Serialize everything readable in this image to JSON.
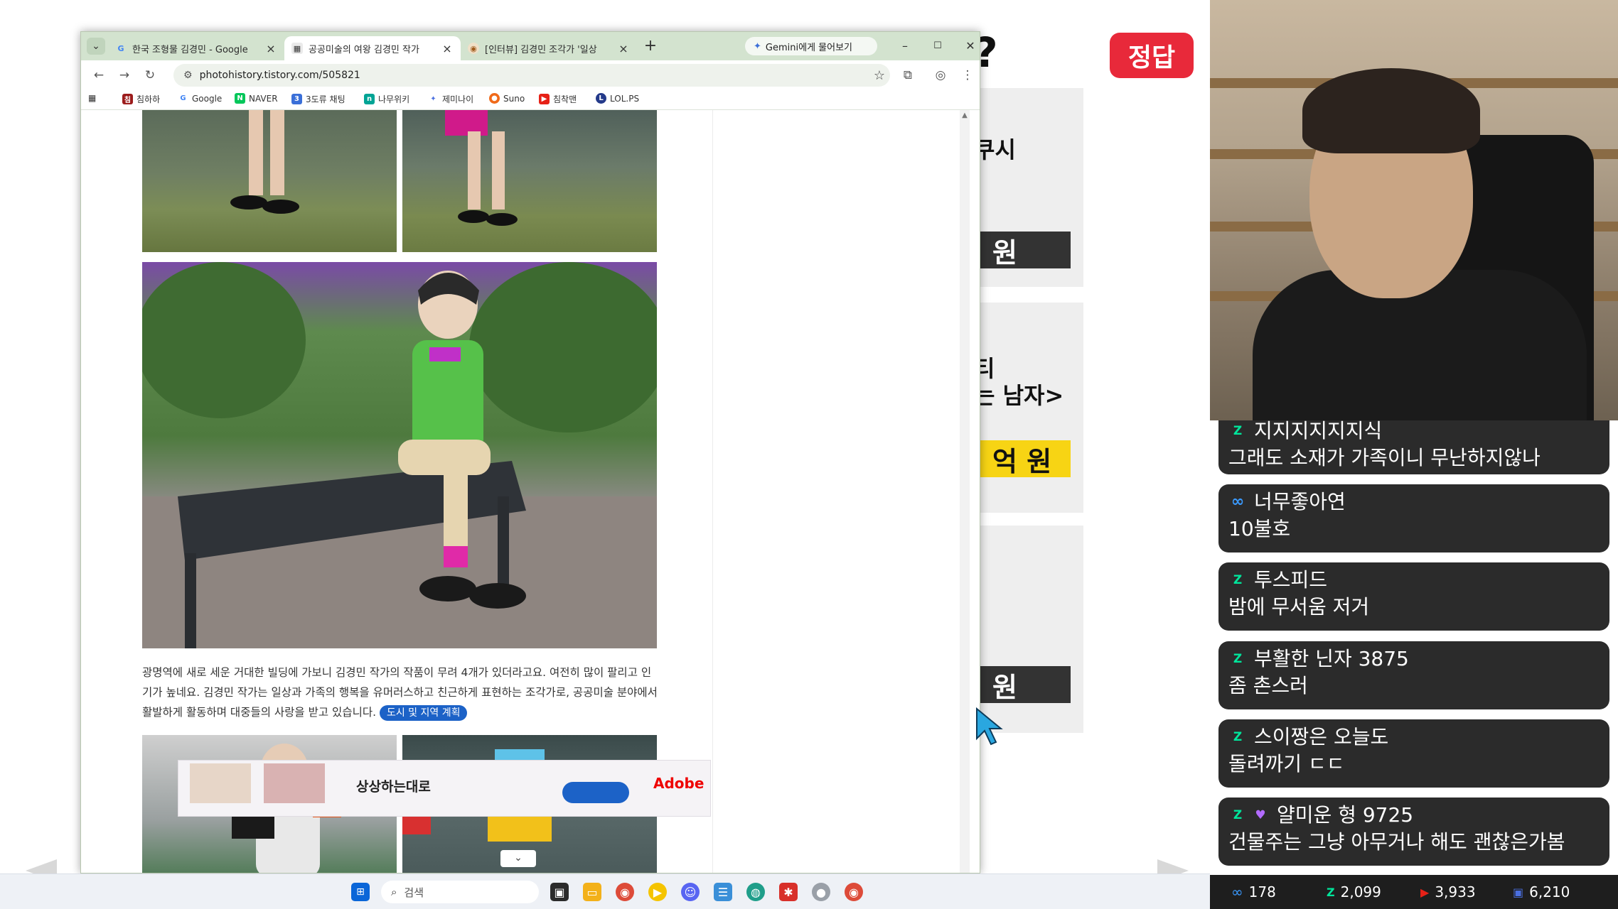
{
  "slide": {
    "title_fragment": "?",
    "answer_badge": "정답",
    "cards": [
      {
        "line1": "쿠시",
        "line2": "",
        "price": "원",
        "price_style": "dark"
      },
      {
        "line1": "티",
        "line2": "는 남자>",
        "price": "억 원",
        "price_style": "yellow"
      },
      {
        "line1": "|",
        "line2": "",
        "price": "원",
        "price_style": "dark"
      }
    ]
  },
  "browser": {
    "tabs": [
      {
        "title": "한국 조형물 김경민 - Google",
        "icon": "google-favicon",
        "active": false
      },
      {
        "title": "공공미술의 여왕 김경민 작가",
        "icon": "tistory-favicon",
        "active": true
      },
      {
        "title": "[인터뷰] 김경민 조각가 '일상",
        "icon": "news-favicon",
        "active": false
      }
    ],
    "gemini_button": "Gemini에게 물어보기",
    "url": "photohistory.tistory.com/505821",
    "bookmarks": [
      {
        "label": "침하하",
        "icon": "chimhaha-icon",
        "color": "#9c1c1c"
      },
      {
        "label": "Google",
        "icon": "google-icon",
        "color": "#4285f4"
      },
      {
        "label": "NAVER",
        "icon": "naver-icon",
        "color": "#03c75a"
      },
      {
        "label": "3도류 채팅",
        "icon": "chat-icon",
        "color": "#3a6fd8"
      },
      {
        "label": "나무위키",
        "icon": "namuwiki-icon",
        "color": "#00a495"
      },
      {
        "label": "제미나이",
        "icon": "gemini-icon",
        "color": "#4a6fe0"
      },
      {
        "label": "Suno",
        "icon": "suno-icon",
        "color": "#f06a1a"
      },
      {
        "label": "침착맨",
        "icon": "youtube-icon",
        "color": "#e62117"
      },
      {
        "label": "LOL.PS",
        "icon": "lolps-icon",
        "color": "#243a8a"
      }
    ]
  },
  "article": {
    "caption": "광명역에 새로 세운 거대한 빌딩에 가보니 김경민 작가의 작품이 무려 4개가 있더라고요. 여전히 많이 팔리고 인기가 높네요. 김경민 작가는 일상과 가족의 행복을 유머러스하고 친근하게 표현하는 조각가로, 공공미술 분야에서 활발하게 활동하며 대중들의 사랑을 받고 있습니다.",
    "link_chip": "도시 및 지역 계획"
  },
  "ad": {
    "headline": "상상하는대로",
    "brand": "Adobe"
  },
  "taskbar": {
    "search_placeholder": "검색"
  },
  "chat": {
    "messages": [
      {
        "user": "지지지지지지식",
        "text": "그래도 소재가 가족이니 무난하지않나",
        "badge": "chzzk"
      },
      {
        "user": "너무좋아연",
        "text": "10불호",
        "badge": "loop"
      },
      {
        "user": "투스피드",
        "text": "밤에 무서움 저거",
        "badge": "chzzk"
      },
      {
        "user": "부활한 닌자 3875",
        "text": "좀 촌스러",
        "badge": "chzzk"
      },
      {
        "user": "스이짱은 오늘도",
        "text": "돌려까기 ㄷㄷ",
        "badge": "chzzk"
      },
      {
        "user": "얄미운 형 9725",
        "text": "건물주는 그냥 아무거나 해도 괜찮은가봄",
        "badge": "chzzk-heart"
      }
    ]
  },
  "stats": [
    {
      "icon": "loop-icon",
      "value": "178",
      "color": "#3a9aff"
    },
    {
      "icon": "chzzk-icon",
      "value": "2,099",
      "color": "#00e59b"
    },
    {
      "icon": "youtube-icon",
      "value": "3,933",
      "color": "#e62117"
    },
    {
      "icon": "viewer-icon",
      "value": "6,210",
      "color": "#4a6fe0"
    }
  ]
}
